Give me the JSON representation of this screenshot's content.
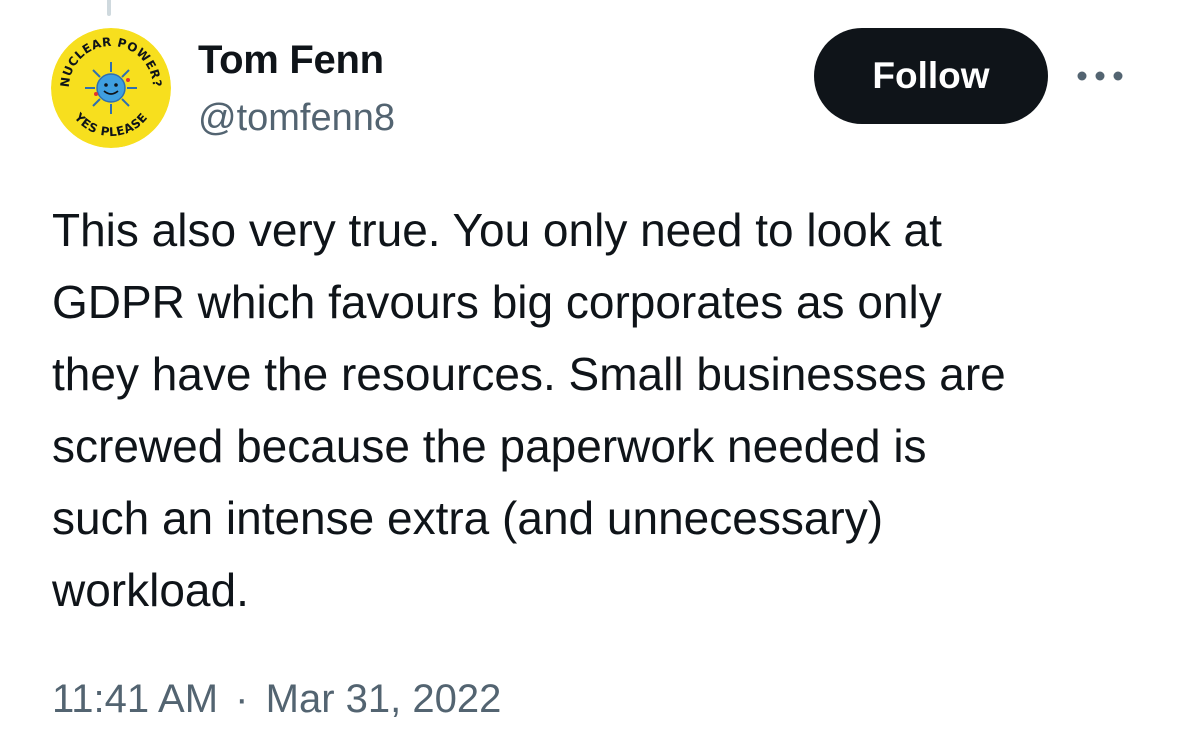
{
  "author": {
    "display_name": "Tom Fenn",
    "handle": "@tomfenn8",
    "avatar": {
      "icon": "nuclear-power-yes-please-badge-icon",
      "top_text": "NUCLEAR POWER?",
      "bottom_text": "YES PLEASE",
      "background_color": "#f7df1e",
      "sun_color": "#3f9fe0"
    }
  },
  "actions": {
    "follow_label": "Follow",
    "more_icon": "more-options-icon"
  },
  "tweet": {
    "text_lines": [
      "This also very true. You only need to look at",
      "GDPR which favours big corporates as only",
      "they have the resources. Small businesses are",
      "screwed because the paperwork needed is",
      "such an intense extra (and unnecessary)",
      "workload."
    ],
    "time": "11:41 AM",
    "separator": "·",
    "date": "Mar 31, 2022"
  },
  "colors": {
    "text_primary": "#0f1419",
    "text_secondary": "#536471",
    "button_bg": "#0f1419",
    "button_text": "#ffffff"
  }
}
